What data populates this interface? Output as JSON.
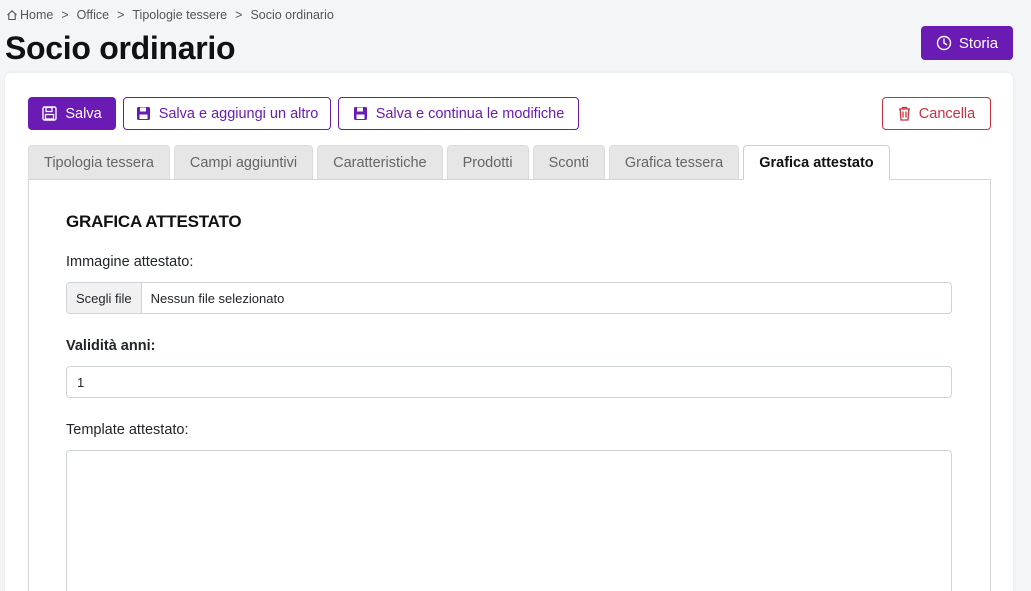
{
  "breadcrumb": {
    "home": "Home",
    "items": [
      "Office",
      "Tipologie tessere",
      "Socio ordinario"
    ],
    "separator": ">"
  },
  "page": {
    "title": "Socio ordinario"
  },
  "header": {
    "storia_label": "Storia"
  },
  "toolbar": {
    "salva_label": "Salva",
    "salva_aggiungi_label": "Salva e aggiungi un altro",
    "salva_continua_label": "Salva e continua le modifiche",
    "cancella_label": "Cancella"
  },
  "tabs": [
    {
      "label": "Tipologia tessera",
      "active": false
    },
    {
      "label": "Campi aggiuntivi",
      "active": false
    },
    {
      "label": "Caratteristiche",
      "active": false
    },
    {
      "label": "Prodotti",
      "active": false
    },
    {
      "label": "Sconti",
      "active": false
    },
    {
      "label": "Grafica tessera",
      "active": false
    },
    {
      "label": "Grafica attestato",
      "active": true
    }
  ],
  "form": {
    "section_title": "GRAFICA ATTESTATO",
    "immagine_label": "Immagine attestato:",
    "file_button": "Scegli file",
    "file_status": "Nessun file selezionato",
    "validita_label": "Validità anni:",
    "validita_value": "1",
    "template_label": "Template attestato:",
    "template_value": ""
  },
  "colors": {
    "primary": "#6a1bb3",
    "danger": "#c9303e"
  },
  "icons": {
    "home": "home-icon",
    "storia": "clock-icon",
    "save": "floppy-disk-icon",
    "delete": "trash-icon"
  }
}
